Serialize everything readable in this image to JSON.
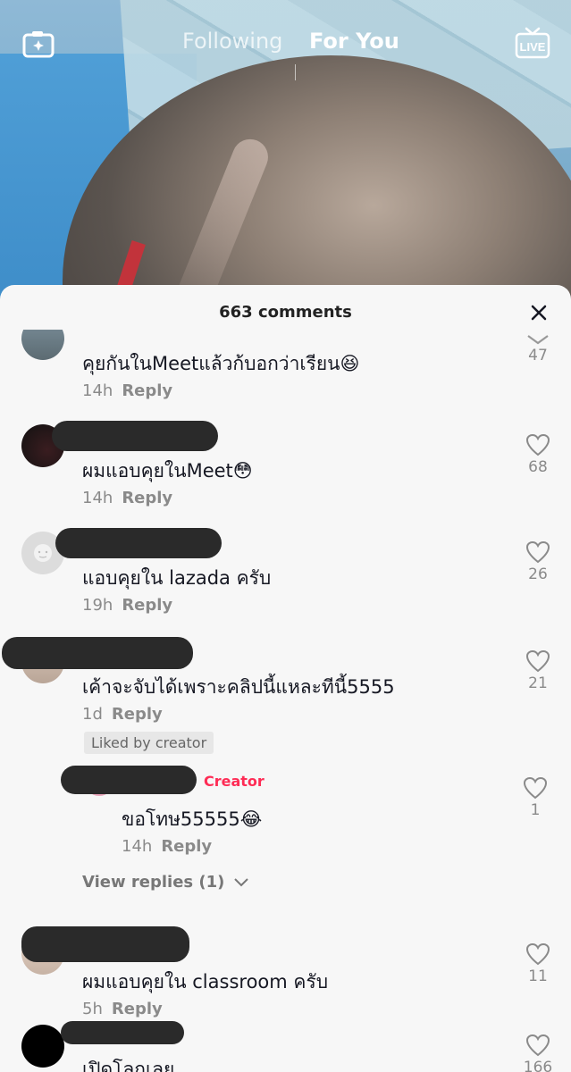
{
  "header": {
    "tab_following": "Following",
    "tab_for_you": "For You"
  },
  "sheet": {
    "title": "663 comments"
  },
  "comments": [
    {
      "text": "คุยกันในMeetแล้วก้บอกว่าเรียน😆",
      "time": "14h",
      "reply": "Reply",
      "likes": "47"
    },
    {
      "text": "ผมแอบคุยในMeet😳",
      "time": "14h",
      "reply": "Reply",
      "likes": "68"
    },
    {
      "text": "แอบคุยใน lazada ครับ",
      "time": "19h",
      "reply": "Reply",
      "likes": "26"
    },
    {
      "text": "เค้าจะจับได้เพราะคลิปนี้แหละทีนี้5555",
      "time": "1d",
      "reply": "Reply",
      "likes": "21",
      "liked_badge": "Liked by creator"
    },
    {
      "creator_tag": "Creator",
      "text": "ขอโทษ55555😂",
      "time": "14h",
      "reply": "Reply",
      "likes": "1"
    },
    {
      "view_replies": "View replies (1)"
    },
    {
      "text": "ผมแอบคุยใน classroom ครับ",
      "time": "5h",
      "reply": "Reply",
      "likes": "11"
    },
    {
      "text": "เปิดโลกเลย",
      "likes": "166"
    }
  ],
  "colors": {
    "accent": "#fe2c55",
    "sheet_bg": "#f7f7f7",
    "muted": "#8a8a8a"
  }
}
